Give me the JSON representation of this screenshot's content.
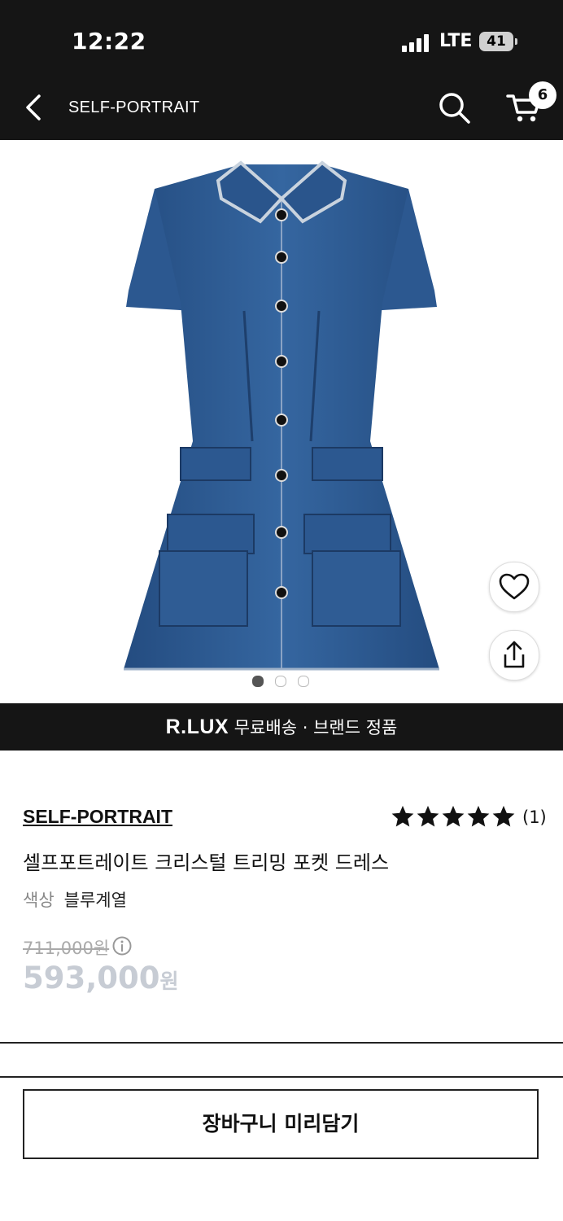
{
  "status_bar": {
    "time": "12:22",
    "network": "LTE",
    "battery": "41"
  },
  "header": {
    "title": "SELF-PORTRAIT",
    "cart_count": "6"
  },
  "gallery": {
    "image_count": 3,
    "active_index": 0
  },
  "banner": {
    "logo": "R.LUX",
    "text": " 무료배송 · 브랜드 정품"
  },
  "product": {
    "brand": "SELF-PORTRAIT",
    "rating_stars": 5,
    "review_count": "(1)",
    "name": "셀프포트레이트 크리스털 트리밍 포켓 드레스",
    "color_label": "색상",
    "color_value": "블루계열",
    "original_price": "711,000원",
    "sale_price": "593,000",
    "sale_currency": "원"
  },
  "actions": {
    "add_to_cart_label": "장바구니 미리담기"
  },
  "colors": {
    "dark": "#151515",
    "denim": "#2f5c94",
    "price_muted": "#c7ccd4"
  }
}
